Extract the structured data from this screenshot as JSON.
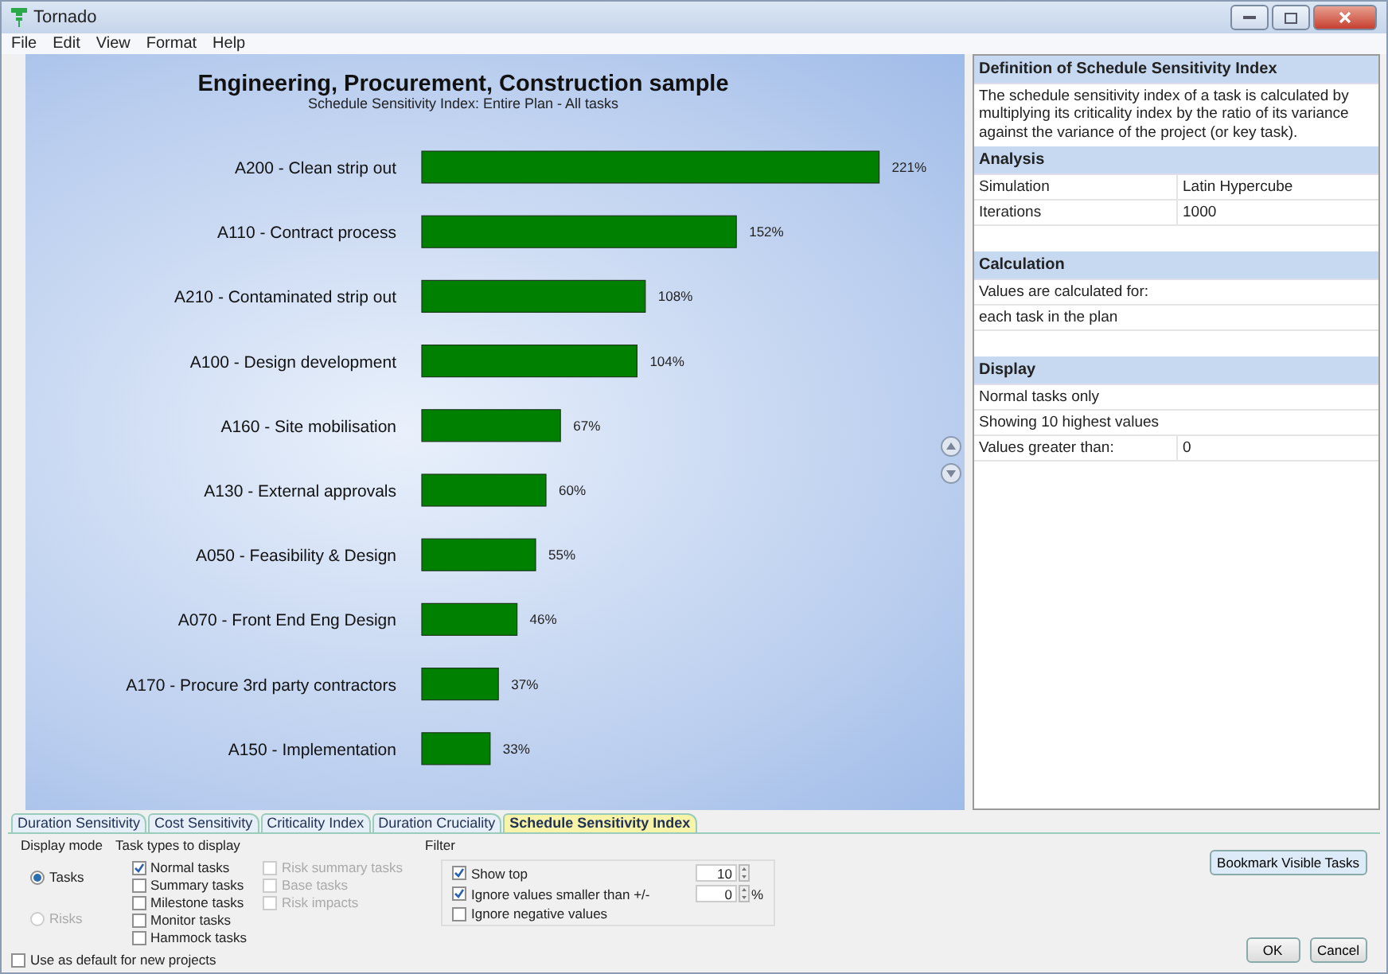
{
  "window": {
    "title": "Tornado"
  },
  "menu": [
    "File",
    "Edit",
    "View",
    "Format",
    "Help"
  ],
  "chart": {
    "title": "Engineering, Procurement, Construction sample",
    "subtitle": "Schedule Sensitivity Index: Entire Plan - All tasks",
    "value_suffix": "%",
    "chart_data": {
      "type": "bar",
      "orientation": "horizontal",
      "data_labels": true,
      "categories": [
        "A200 - Clean strip out",
        "A110 - Contract process",
        "A210 - Contaminated strip out",
        "A100 - Design development",
        "A160 - Site mobilisation",
        "A130 - External approvals",
        "A050 - Feasibility & Design",
        "A070 - Front End Eng Design",
        "A170 - Procure 3rd party contractors",
        "A150 - Implementation"
      ],
      "series": [
        {
          "color": "#008000",
          "values": [
            221,
            152,
            108,
            104,
            67,
            60,
            55,
            46,
            37,
            33
          ]
        }
      ]
    }
  },
  "info_panel": [
    {
      "heading": "Definition of Schedule Sensitivity Index",
      "kind": "text",
      "text": "The schedule sensitivity index of a task is calculated by multiplying its criticality index by the ratio of its variance against the variance of the project (or key task)."
    },
    {
      "heading": "Analysis",
      "kind": "table",
      "rows": [
        [
          "Simulation",
          "Latin Hypercube"
        ],
        [
          "Iterations",
          "1000"
        ]
      ]
    },
    {
      "heading": "Calculation",
      "kind": "table",
      "rows": [
        [
          "Values are calculated for:"
        ],
        [
          "each task in the plan"
        ]
      ]
    },
    {
      "heading": "Display",
      "kind": "table",
      "rows": [
        [
          "Normal tasks only"
        ],
        [
          "Showing 10 highest values"
        ],
        [
          "Values greater than:",
          "0"
        ]
      ]
    }
  ],
  "tabs": [
    {
      "label": "Duration Sensitivity",
      "selected": false
    },
    {
      "label": "Cost Sensitivity",
      "selected": false
    },
    {
      "label": "Criticality Index",
      "selected": false
    },
    {
      "label": "Duration Cruciality",
      "selected": false
    },
    {
      "label": "Schedule Sensitivity Index",
      "selected": true
    }
  ],
  "display_mode": {
    "label": "Display mode",
    "options": [
      {
        "label": "Tasks",
        "selected": true,
        "disabled": false
      },
      {
        "label": "Risks",
        "selected": false,
        "disabled": true
      }
    ]
  },
  "task_types": {
    "label": "Task types to display",
    "columns": [
      [
        {
          "label": "Normal tasks",
          "checked": true,
          "disabled": false
        },
        {
          "label": "Summary tasks",
          "checked": false,
          "disabled": false
        },
        {
          "label": "Milestone tasks",
          "checked": false,
          "disabled": false
        },
        {
          "label": "Monitor tasks",
          "checked": false,
          "disabled": false
        },
        {
          "label": "Hammock tasks",
          "checked": false,
          "disabled": false
        }
      ],
      [
        {
          "label": "Risk summary tasks",
          "checked": false,
          "disabled": true
        },
        {
          "label": "Base tasks",
          "checked": false,
          "disabled": true
        },
        {
          "label": "Risk impacts",
          "checked": false,
          "disabled": true
        }
      ]
    ]
  },
  "filter": {
    "label": "Filter",
    "items": [
      {
        "kind": "spin",
        "label": "Show top",
        "checked": true,
        "value": "10"
      },
      {
        "kind": "spin",
        "label": "Ignore values smaller than +/-",
        "checked": true,
        "value": "0",
        "unit": "%"
      },
      {
        "kind": "plain",
        "label": "Ignore negative values",
        "checked": false
      }
    ]
  },
  "default_option": {
    "label": "Use as default for new projects",
    "checked": false
  },
  "buttons": {
    "bookmark": "Bookmark Visible Tasks",
    "ok": "OK",
    "cancel": "Cancel"
  }
}
